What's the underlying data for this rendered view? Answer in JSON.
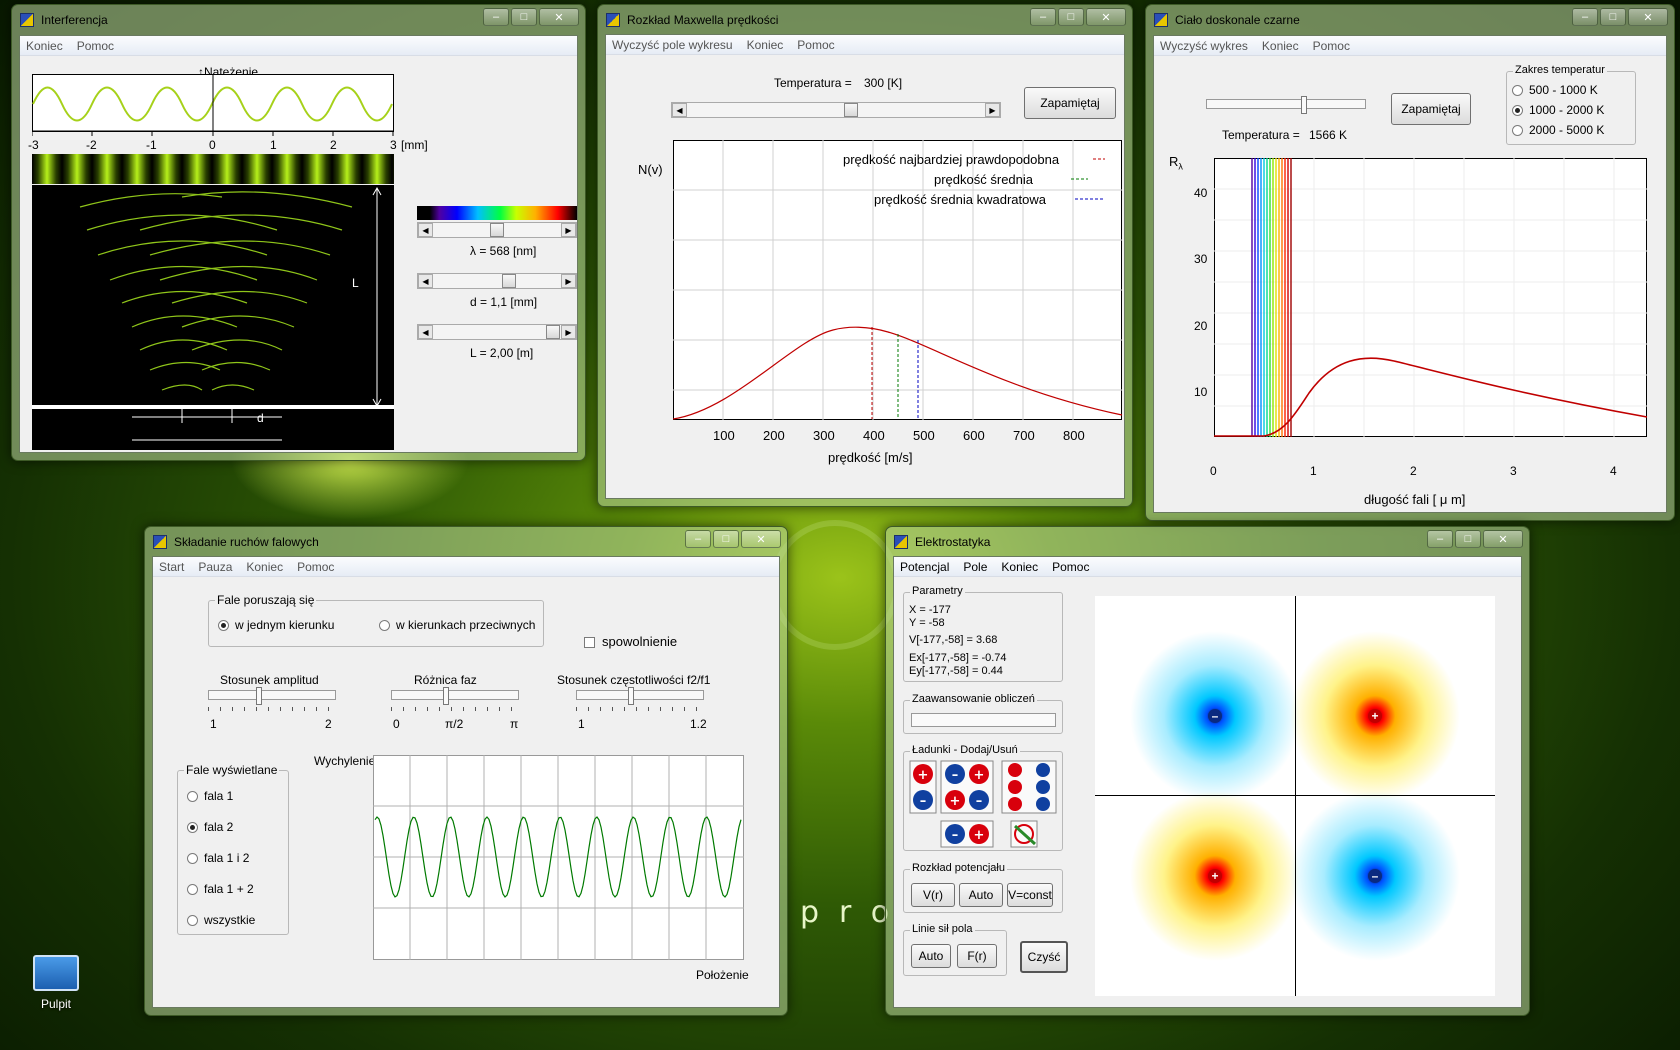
{
  "desktop": {
    "icon_label": "Pulpit",
    "watermark": "pro"
  },
  "win_interf": {
    "title": "Interferencja",
    "menu": [
      "Koniec",
      "Pomoc"
    ],
    "axis_label": "Natężenie",
    "x_ticks": [
      "-3",
      "-2",
      "-1",
      "0",
      "1",
      "2",
      "3"
    ],
    "x_unit": "[mm]",
    "label_L": "L",
    "label_d": "d",
    "lambda_label": "λ = 568 [nm]",
    "d_label": "d = 1,1 [mm]",
    "L_label": "L = 2,00 [m]"
  },
  "win_maxwell": {
    "title": "Rozkład Maxwella prędkości",
    "menu": [
      "Wyczyść pole wykresu",
      "Koniec",
      "Pomoc"
    ],
    "temp_label": "Temperatura =",
    "temp_value": "300 [K]",
    "save_button": "Zapamiętaj",
    "ylabel": "N(v)",
    "legend": [
      "prędkość najbardziej prawdopodobna",
      "prędkość średnia",
      "prędkość średnia kwadratowa"
    ],
    "x_ticks": [
      "100",
      "200",
      "300",
      "400",
      "500",
      "600",
      "700",
      "800"
    ],
    "xlabel": "prędkość [m/s]"
  },
  "win_blackbody": {
    "title": "Ciało doskonale czarne",
    "menu": [
      "Wyczyść wykres",
      "Koniec",
      "Pomoc"
    ],
    "temp_label": "Temperatura =",
    "temp_value": "1566 K",
    "save_button": "Zapamiętaj",
    "range_group": "Zakres temperatur",
    "ranges": [
      "500 - 1000 K",
      "1000 - 2000 K",
      "2000 - 5000 K"
    ],
    "ylabel": "R",
    "ylabel_sub": "λ",
    "y_ticks": [
      "40",
      "30",
      "20",
      "10"
    ],
    "x_ticks": [
      "0",
      "1",
      "2",
      "3",
      "4"
    ],
    "xlabel": "długość fali [ μ m]"
  },
  "win_waves": {
    "title": "Składanie ruchów falowych",
    "menu": [
      "Start",
      "Pauza",
      "Koniec",
      "Pomoc"
    ],
    "dir_group": "Fale poruszają się",
    "dir_opts": [
      "w jednym kierunku",
      "w kierunkach przeciwnych"
    ],
    "slow_label": "spowolnienie",
    "amp_label": "Stosunek amplitud",
    "amp_ticks": [
      "1",
      "2"
    ],
    "phase_label": "Różnica faz",
    "phase_ticks": [
      "0",
      "π/2",
      "π"
    ],
    "freq_label": "Stosunek częstotliwości f2/f1",
    "freq_ticks": [
      "1",
      "1.2"
    ],
    "show_group": "Fale wyświetlane",
    "show_opts": [
      "fala 1",
      "fala 2",
      "fala 1 i 2",
      "fala 1 + 2",
      "wszystkie"
    ],
    "ylabel": "Wychylenie",
    "xlabel": "Położenie"
  },
  "win_electro": {
    "title": "Elektrostatyka",
    "menu": [
      "Potencjal",
      "Pole",
      "Koniec",
      "Pomoc"
    ],
    "params_group": "Parametry",
    "params": [
      "X = -177",
      "Y = -58",
      "V[-177,-58]  = 3.68",
      "Ex[-177,-58] = -0.74",
      "Ey[-177,-58] = 0.44"
    ],
    "progress_group": "Zaawansowanie obliczeń",
    "charges_group": "Ładunki - Dodaj/Usuń",
    "potential_group": "Rozkład potencjału",
    "potential_buttons": [
      "V(r)",
      "Auto",
      "V=const"
    ],
    "lines_group": "Linie sił pola",
    "lines_buttons": [
      "Auto",
      "F(r)"
    ],
    "clear_button": "Czyść"
  }
}
